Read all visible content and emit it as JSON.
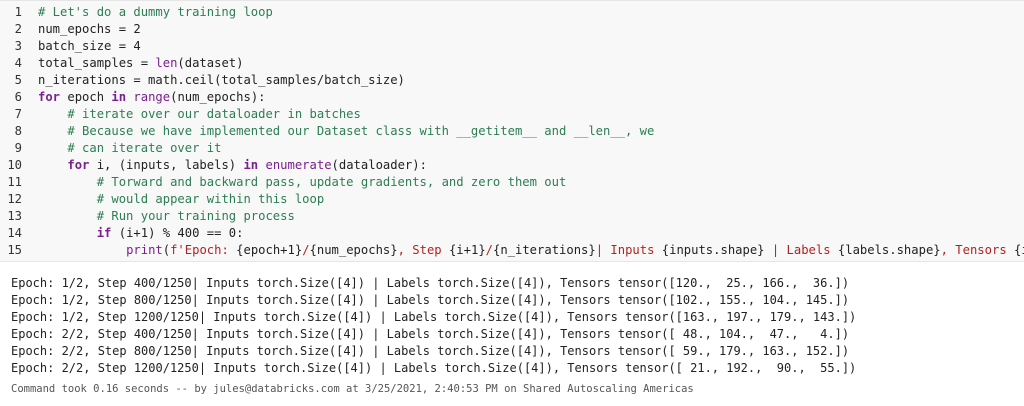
{
  "code_cell": {
    "lines": [
      {
        "n": "1",
        "tokens": [
          {
            "t": "# Let's do a dummy training loop",
            "c": "cm"
          }
        ]
      },
      {
        "n": "2",
        "tokens": [
          {
            "t": "num_epochs = 2",
            "c": ""
          }
        ]
      },
      {
        "n": "3",
        "tokens": [
          {
            "t": "batch_size = 4",
            "c": ""
          }
        ]
      },
      {
        "n": "4",
        "tokens": [
          {
            "t": "total_samples = ",
            "c": ""
          },
          {
            "t": "len",
            "c": "bi"
          },
          {
            "t": "(dataset)",
            "c": ""
          }
        ]
      },
      {
        "n": "5",
        "tokens": [
          {
            "t": "n_iterations = math.ceil(total_samples/batch_size)",
            "c": ""
          }
        ]
      },
      {
        "n": "6",
        "tokens": [
          {
            "t": "for",
            "c": "kw"
          },
          {
            "t": " epoch ",
            "c": ""
          },
          {
            "t": "in",
            "c": "kw"
          },
          {
            "t": " ",
            "c": ""
          },
          {
            "t": "range",
            "c": "bi"
          },
          {
            "t": "(num_epochs):",
            "c": ""
          }
        ]
      },
      {
        "n": "7",
        "tokens": [
          {
            "t": "    ",
            "c": ""
          },
          {
            "t": "# iterate over our dataloader in batches",
            "c": "cm"
          }
        ]
      },
      {
        "n": "8",
        "tokens": [
          {
            "t": "    ",
            "c": ""
          },
          {
            "t": "# Because we have implemented our Dataset class with __getitem__ and __len__, we",
            "c": "cm"
          }
        ]
      },
      {
        "n": "9",
        "tokens": [
          {
            "t": "    ",
            "c": ""
          },
          {
            "t": "# can iterate over it",
            "c": "cm"
          }
        ]
      },
      {
        "n": "10",
        "tokens": [
          {
            "t": "    ",
            "c": ""
          },
          {
            "t": "for",
            "c": "kw"
          },
          {
            "t": " i, (inputs, labels) ",
            "c": ""
          },
          {
            "t": "in",
            "c": "kw"
          },
          {
            "t": " ",
            "c": ""
          },
          {
            "t": "enumerate",
            "c": "bi"
          },
          {
            "t": "(dataloader):",
            "c": ""
          }
        ]
      },
      {
        "n": "11",
        "tokens": [
          {
            "t": "        ",
            "c": ""
          },
          {
            "t": "# Torward and backward pass, update gradients, and zero them out",
            "c": "cm"
          }
        ]
      },
      {
        "n": "12",
        "tokens": [
          {
            "t": "        ",
            "c": ""
          },
          {
            "t": "# would appear within this loop",
            "c": "cm"
          }
        ]
      },
      {
        "n": "13",
        "tokens": [
          {
            "t": "        ",
            "c": ""
          },
          {
            "t": "# Run your training process",
            "c": "cm"
          }
        ]
      },
      {
        "n": "14",
        "tokens": [
          {
            "t": "        ",
            "c": ""
          },
          {
            "t": "if",
            "c": "kw"
          },
          {
            "t": " (i+1) % 400 == 0:",
            "c": ""
          }
        ]
      },
      {
        "n": "15",
        "tokens": [
          {
            "t": "            ",
            "c": ""
          },
          {
            "t": "print",
            "c": "bi"
          },
          {
            "t": "(",
            "c": ""
          },
          {
            "t": "f'Epoch: ",
            "c": "str"
          },
          {
            "t": "{epoch+1}",
            "c": ""
          },
          {
            "t": "/",
            "c": "str"
          },
          {
            "t": "{num_epochs}",
            "c": ""
          },
          {
            "t": ", Step ",
            "c": "str"
          },
          {
            "t": "{i+1}",
            "c": ""
          },
          {
            "t": "/",
            "c": "str"
          },
          {
            "t": "{n_iterations}",
            "c": ""
          },
          {
            "t": "| Inputs ",
            "c": "str"
          },
          {
            "t": "{inputs.shape}",
            "c": ""
          },
          {
            "t": " | Labels ",
            "c": "str"
          },
          {
            "t": "{labels.shape}",
            "c": ""
          },
          {
            "t": ", Tensors ",
            "c": "str"
          },
          {
            "t": "{inputs}",
            "c": ""
          },
          {
            "t": "')",
            "c": "str"
          }
        ]
      }
    ]
  },
  "output": {
    "lines": [
      "Epoch: 1/2, Step 400/1250| Inputs torch.Size([4]) | Labels torch.Size([4]), Tensors tensor([120.,  25., 166.,  36.])",
      "Epoch: 1/2, Step 800/1250| Inputs torch.Size([4]) | Labels torch.Size([4]), Tensors tensor([102., 155., 104., 145.])",
      "Epoch: 1/2, Step 1200/1250| Inputs torch.Size([4]) | Labels torch.Size([4]), Tensors tensor([163., 197., 179., 143.])",
      "Epoch: 2/2, Step 400/1250| Inputs torch.Size([4]) | Labels torch.Size([4]), Tensors tensor([ 48., 104.,  47.,   4.])",
      "Epoch: 2/2, Step 800/1250| Inputs torch.Size([4]) | Labels torch.Size([4]), Tensors tensor([ 59., 179., 163., 152.])",
      "Epoch: 2/2, Step 1200/1250| Inputs torch.Size([4]) | Labels torch.Size([4]), Tensors tensor([ 21., 192.,  90.,  55.])"
    ],
    "status": "Command took 0.16 seconds -- by jules@databricks.com at 3/25/2021, 2:40:53 PM on Shared Autoscaling Americas"
  }
}
